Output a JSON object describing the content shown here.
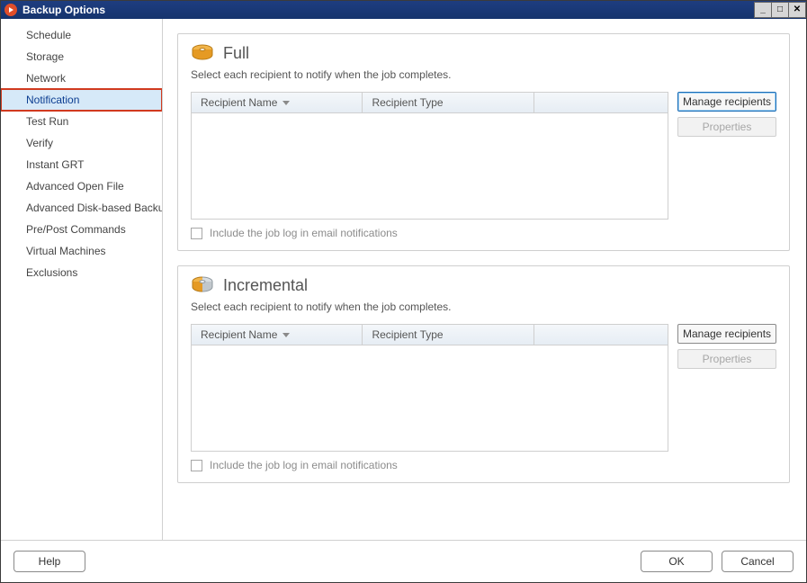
{
  "window": {
    "title": "Backup Options"
  },
  "winbtns": {
    "min": "_",
    "max": "□",
    "close": "✕"
  },
  "sidebar": {
    "items": [
      {
        "label": "Schedule"
      },
      {
        "label": "Storage"
      },
      {
        "label": "Network"
      },
      {
        "label": "Notification",
        "selected": true,
        "highlighted": true
      },
      {
        "label": "Test Run"
      },
      {
        "label": "Verify"
      },
      {
        "label": "Instant GRT"
      },
      {
        "label": "Advanced Open File"
      },
      {
        "label": "Advanced Disk-based Backup"
      },
      {
        "label": "Pre/Post Commands"
      },
      {
        "label": "Virtual Machines"
      },
      {
        "label": "Exclusions"
      }
    ]
  },
  "panel_full": {
    "title": "Full",
    "desc": "Select each recipient to notify when the job completes.",
    "columns": [
      "Recipient Name",
      "Recipient Type",
      ""
    ],
    "manage_btn": "Manage recipients",
    "props_btn": "Properties",
    "include_log_label": "Include the job log in email notifications"
  },
  "panel_inc": {
    "title": "Incremental",
    "desc": "Select each recipient to notify when the job completes.",
    "columns": [
      "Recipient Name",
      "Recipient Type",
      ""
    ],
    "manage_btn": "Manage recipients",
    "props_btn": "Properties",
    "include_log_label": "Include the job log in email notifications"
  },
  "footer": {
    "help": "Help",
    "ok": "OK",
    "cancel": "Cancel"
  }
}
